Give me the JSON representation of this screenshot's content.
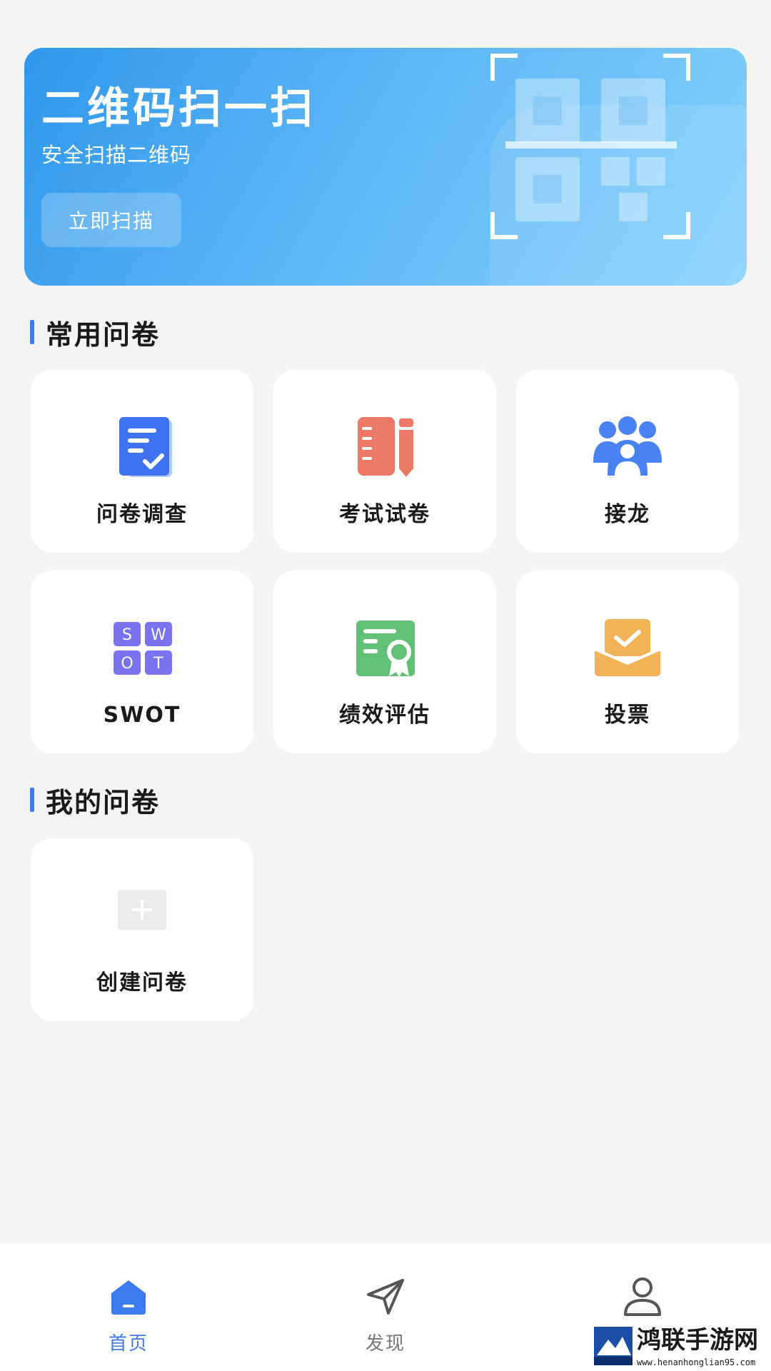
{
  "banner": {
    "title": "二维码扫一扫",
    "subtitle": "安全扫描二维码",
    "button_label": "立即扫描",
    "icon": "qr-scan-icon"
  },
  "common_section": {
    "title": "常用问卷",
    "cards": [
      {
        "label": "问卷调查",
        "icon": "survey-doc-icon",
        "color": "#3f72f3"
      },
      {
        "label": "考试试卷",
        "icon": "exam-notebook-icon",
        "color": "#ec7866"
      },
      {
        "label": "接龙",
        "icon": "people-group-icon",
        "color": "#4a82f4"
      },
      {
        "label": "SWOT",
        "icon": "swot-grid-icon",
        "color": "#7a72ef"
      },
      {
        "label": "绩效评估",
        "icon": "certificate-icon",
        "color": "#5fc076"
      },
      {
        "label": "投票",
        "icon": "vote-envelope-icon",
        "color": "#f2b357"
      }
    ],
    "swot_letters": [
      "S",
      "W",
      "O",
      "T"
    ]
  },
  "my_section": {
    "title": "我的问卷",
    "create_label": "创建问卷",
    "create_icon": "plus-icon"
  },
  "bottom_nav": {
    "items": [
      {
        "label": "首页",
        "icon": "home-icon",
        "active": true
      },
      {
        "label": "发现",
        "icon": "paper-plane-icon",
        "active": false
      },
      {
        "label": "",
        "icon": "user-icon",
        "active": false
      }
    ],
    "active_color": "#3d7cf0"
  },
  "watermark": {
    "text": "鸿联手游网",
    "url": "www.henanhonglian95.com"
  }
}
